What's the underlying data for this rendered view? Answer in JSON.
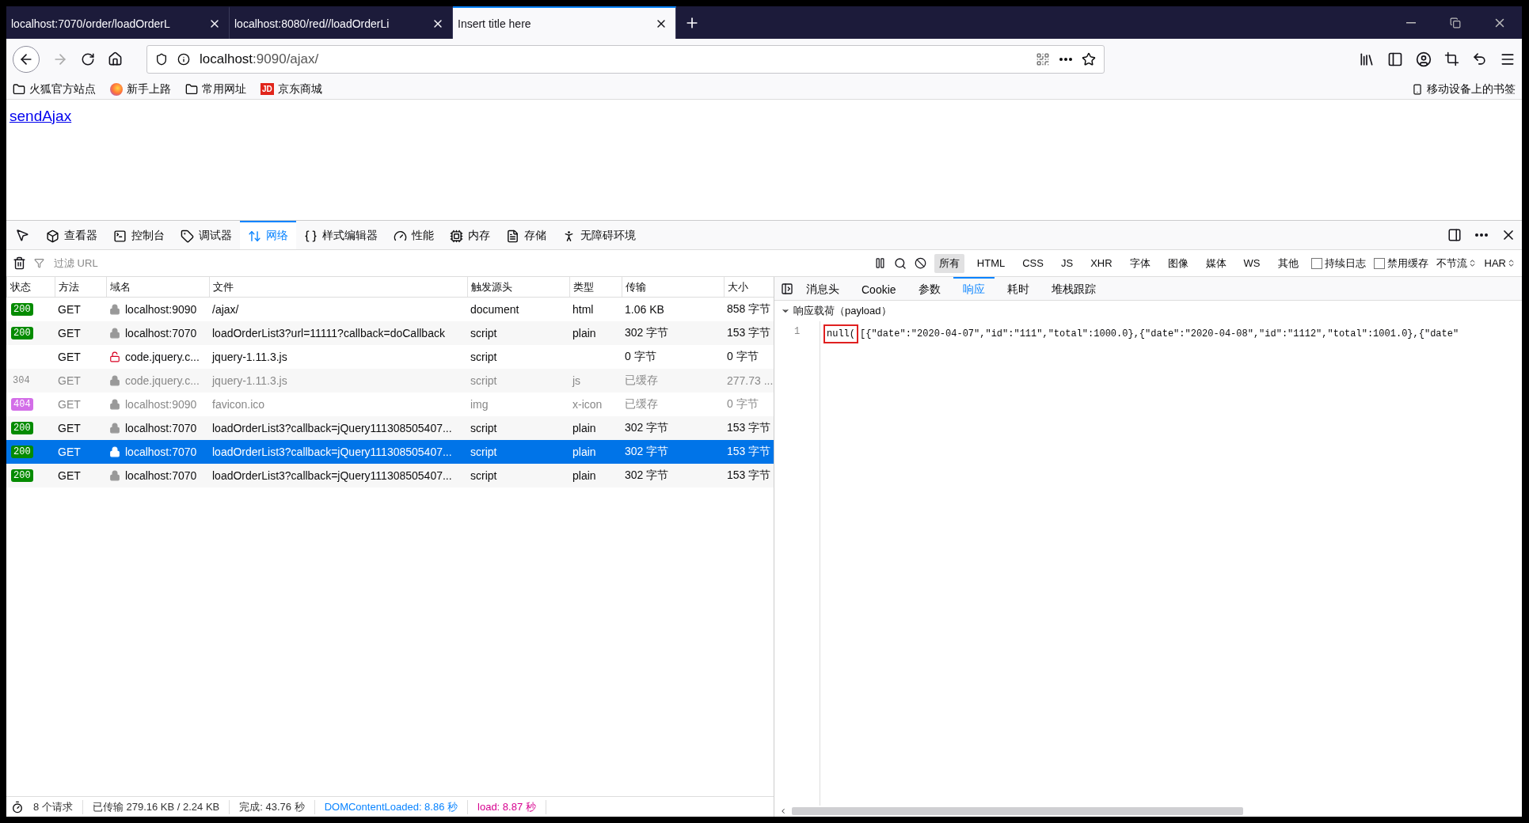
{
  "browser": {
    "tabs": [
      {
        "title": "localhost:7070/order/loadOrderL",
        "selected": false
      },
      {
        "title": "localhost:8080/red//loadOrderLi",
        "selected": false
      },
      {
        "title": "Insert title here",
        "selected": true
      }
    ],
    "url": {
      "host": "localhost",
      "rest": ":9090/ajax/"
    },
    "bookmarks": [
      {
        "label": "火狐官方站点",
        "kind": "folder"
      },
      {
        "label": "新手上路",
        "kind": "firefox"
      },
      {
        "label": "常用网址",
        "kind": "folder"
      },
      {
        "label": "京东商城",
        "kind": "badge",
        "badge": "JD"
      }
    ],
    "mobile_bookmarks": "移动设备上的书签"
  },
  "page": {
    "link": "sendAjax"
  },
  "devtools": {
    "tools": [
      {
        "label": "查看器",
        "kind": "inspector",
        "selected": false
      },
      {
        "label": "控制台",
        "kind": "console",
        "selected": false
      },
      {
        "label": "调试器",
        "kind": "debugger",
        "selected": false
      },
      {
        "label": "网络",
        "kind": "network",
        "selected": true
      },
      {
        "label": "样式编辑器",
        "kind": "style",
        "selected": false
      },
      {
        "label": "性能",
        "kind": "performance",
        "selected": false
      },
      {
        "label": "内存",
        "kind": "memory",
        "selected": false
      },
      {
        "label": "存储",
        "kind": "storage",
        "selected": false
      },
      {
        "label": "无障碍环境",
        "kind": "accessibility",
        "selected": false
      }
    ],
    "filter": {
      "placeholder": "过滤 URL"
    },
    "type_filters": [
      {
        "label": "所有",
        "selected": true
      },
      {
        "label": "HTML",
        "selected": false
      },
      {
        "label": "CSS",
        "selected": false
      },
      {
        "label": "JS",
        "selected": false
      },
      {
        "label": "XHR",
        "selected": false
      },
      {
        "label": "字体",
        "selected": false
      },
      {
        "label": "图像",
        "selected": false
      },
      {
        "label": "媒体",
        "selected": false
      },
      {
        "label": "WS",
        "selected": false
      },
      {
        "label": "其他",
        "selected": false
      }
    ],
    "options": [
      {
        "label": "持续日志",
        "checked": false
      },
      {
        "label": "禁用缓存",
        "checked": false
      }
    ],
    "throttle": "不节流",
    "har": "HAR",
    "table": {
      "columns": [
        "状态",
        "方法",
        "域名",
        "文件",
        "触发源头",
        "类型",
        "传输",
        "大小"
      ],
      "rows": [
        {
          "status": "200",
          "color": "#058b00",
          "method": "GET",
          "blocked": false,
          "domain": "localhost:9090",
          "file": "/ajax/",
          "cause": "document",
          "type": "html",
          "transferred": "1.06 KB",
          "size": "858 字节",
          "greyed": false,
          "selected": false
        },
        {
          "status": "200",
          "color": "#058b00",
          "method": "GET",
          "blocked": false,
          "domain": "localhost:7070",
          "file": "loadOrderList3?url=11111?callback=doCallback",
          "cause": "script",
          "type": "plain",
          "transferred": "302 字节",
          "size": "153 字节",
          "greyed": false,
          "selected": false
        },
        {
          "method": "GET",
          "blocked": true,
          "domain": "code.jquery.c...",
          "file": "jquery-1.11.3.js",
          "cause": "script",
          "transferred": "0 字节",
          "size": "0 字节",
          "greyed": false,
          "selected": false
        },
        {
          "status": "304",
          "method": "GET",
          "blocked": false,
          "domain": "code.jquery.c...",
          "file": "jquery-1.11.3.js",
          "cause": "script",
          "type": "js",
          "transferred": "已缓存",
          "size": "277.73 ...",
          "greyed": true,
          "selected": false
        },
        {
          "status": "404",
          "color": "#d36ee8",
          "method": "GET",
          "blocked": false,
          "domain": "localhost:9090",
          "file": "favicon.ico",
          "cause": "img",
          "type": "x-icon",
          "transferred": "已缓存",
          "size": "0 字节",
          "greyed": true,
          "selected": false
        },
        {
          "status": "200",
          "color": "#058b00",
          "method": "GET",
          "blocked": false,
          "domain": "localhost:7070",
          "file": "loadOrderList3?callback=jQuery111308505407...",
          "cause": "script",
          "type": "plain",
          "transferred": "302 字节",
          "size": "153 字节",
          "greyed": false,
          "selected": false
        },
        {
          "status": "200",
          "color": "#058b00",
          "method": "GET",
          "blocked": false,
          "domain": "localhost:7070",
          "file": "loadOrderList3?callback=jQuery111308505407...",
          "cause": "script",
          "type": "plain",
          "transferred": "302 字节",
          "size": "153 字节",
          "greyed": false,
          "selected": true
        },
        {
          "status": "200",
          "color": "#058b00",
          "method": "GET",
          "blocked": false,
          "domain": "localhost:7070",
          "file": "loadOrderList3?callback=jQuery111308505407...",
          "cause": "script",
          "type": "plain",
          "transferred": "302 字节",
          "size": "153 字节",
          "greyed": false,
          "selected": false
        }
      ]
    },
    "status_bar": [
      {
        "text": "8 个请求",
        "kind": "plain"
      },
      {
        "text": "已传输 279.16 KB / 2.24 KB",
        "kind": "plain"
      },
      {
        "text": "完成: 43.76 秒",
        "kind": "plain"
      },
      {
        "text": "DOMContentLoaded: 8.86 秒",
        "kind": "dom"
      },
      {
        "text": "load: 8.87 秒",
        "kind": "load"
      }
    ],
    "details": {
      "tabs": [
        {
          "label": "消息头",
          "selected": false
        },
        {
          "label": "Cookie",
          "selected": false
        },
        {
          "label": "参数",
          "selected": false
        },
        {
          "label": "响应",
          "selected": true
        },
        {
          "label": "耗时",
          "selected": false
        },
        {
          "label": "堆栈跟踪",
          "selected": false
        }
      ],
      "section": {
        "title": "响应载荷（payload）",
        "expanded": true
      },
      "code": [
        {
          "number": "1",
          "highlight": "null(",
          "text": "[{\"date\":\"2020-04-07\",\"id\":\"111\",\"total\":1000.0},{\"date\":\"2020-04-08\",\"id\":\"1112\",\"total\":1001.0},{\"date\""
        }
      ]
    }
  }
}
